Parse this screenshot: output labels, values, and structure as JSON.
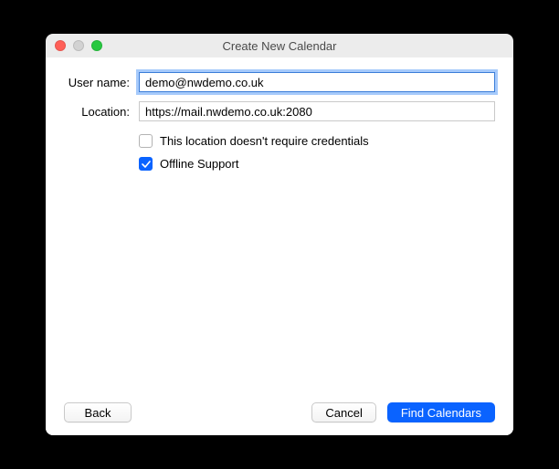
{
  "window": {
    "title": "Create New Calendar"
  },
  "form": {
    "username_label": "User name:",
    "username_value": "demo@nwdemo.co.uk",
    "location_label": "Location:",
    "location_value": "https://mail.nwdemo.co.uk:2080",
    "no_credentials_label": "This location doesn't require credentials",
    "no_credentials_checked": false,
    "offline_label": "Offline Support",
    "offline_checked": true
  },
  "buttons": {
    "back": "Back",
    "cancel": "Cancel",
    "find": "Find Calendars"
  }
}
